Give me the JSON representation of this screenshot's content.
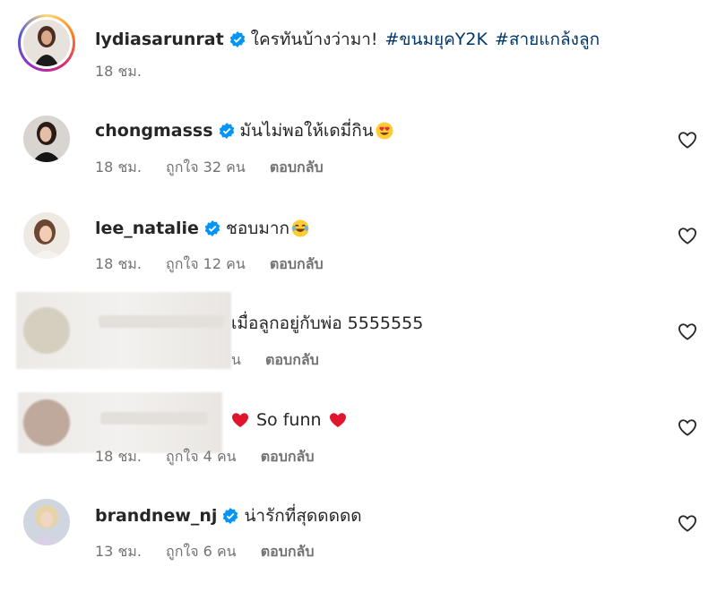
{
  "caption": {
    "username": "lydiasarunrat",
    "text": "ใครทันบ้างว่ามา!",
    "hashtags": [
      "#ขนมยุคY2K",
      "#สายแกล้งลูก"
    ],
    "time": "18 ชม."
  },
  "comments": [
    {
      "username": "chongmasss",
      "text": "มันไม่พอให้เดมี่กิน",
      "emoji": "heart-eyes",
      "time": "18 ชม.",
      "likes": "ถูกใจ 32 คน",
      "reply": "ตอบกลับ"
    },
    {
      "username": "lee_natalie",
      "text": "ชอบมาก",
      "emoji": "tears-of-joy",
      "time": "18 ชม.",
      "likes": "ถูกใจ 12 คน",
      "reply": "ตอบกลับ"
    },
    {
      "username": "",
      "text": "เมื่อลูกอยู่กับพ่อ 5555555",
      "time": "",
      "likes": "น",
      "reply": "ตอบกลับ"
    },
    {
      "username": "",
      "text": "So funn",
      "emoji": "red-heart",
      "time": "18 ชม.",
      "likes": "ถูกใจ 4 คน",
      "reply": "ตอบกลับ"
    },
    {
      "username": "brandnew_nj",
      "text": "น่ารักที่สุดดดดด",
      "time": "13 ชม.",
      "likes": "ถูกใจ 6 คน",
      "reply": "ตอบกลับ"
    }
  ],
  "colors": {
    "verified": "#0095f6",
    "hashtag": "#00376b",
    "meta": "#737373"
  }
}
